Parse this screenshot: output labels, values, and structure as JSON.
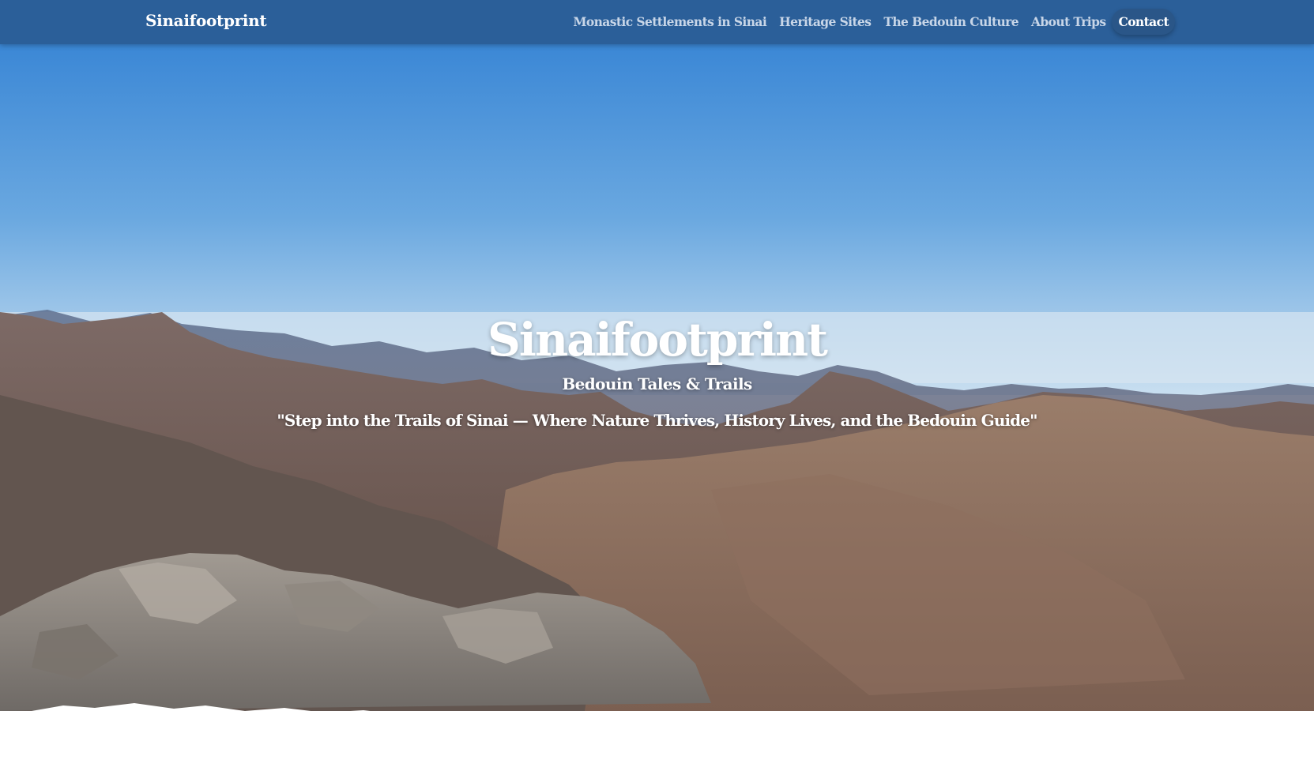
{
  "nav": {
    "brand": "Sinaifootprint",
    "links": [
      {
        "label": "Monastic Settlements in Sinai"
      },
      {
        "label": "Heritage Sites"
      },
      {
        "label": "The Bedouin Culture"
      },
      {
        "label": "About Trips"
      },
      {
        "label": "Contact"
      }
    ]
  },
  "hero": {
    "title": "Sinaifootprint",
    "subtitle": "Bedouin Tales & Trails",
    "quote": "\"Step into the Trails of Sinai — Where Nature Thrives, History Lives, and the Bedouin Guide\""
  },
  "colors": {
    "navbar": "#2b5f99",
    "sky_top": "#2f7fd3",
    "sky_bottom": "#bcd8ee",
    "text": "#ffffff"
  }
}
